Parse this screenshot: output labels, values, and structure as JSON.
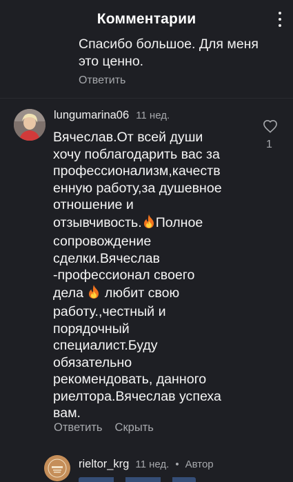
{
  "header": {
    "title": "Комментарии",
    "more_icon": "more-vertical-icon"
  },
  "previous_reply": {
    "text": "Спасибо большое. Для меня это ценно.",
    "reply_label": "Ответить"
  },
  "comment": {
    "username": "lungumarina06",
    "time": "11 нед.",
    "like_icon": "heart-icon",
    "like_count": "1",
    "text_lines": [
      "Вячеслав.От всей души",
      "хочу поблагодарить вас за",
      "профессионализм,качеств",
      "енную работу,за душевное",
      "отношение и",
      "отзывчивость.",
      "Полное",
      "сопровождение",
      "сделки.Вячеслав",
      "-профессионал своего",
      "дела",
      "любит свою",
      "работу.,честный и",
      "порядочный",
      "специалист.Буду",
      "обязательно",
      "рекомендовать, данного",
      "риелтора.Вячеслав успеха",
      "вам."
    ],
    "reply_label": "Ответить",
    "hide_label": "Скрыть"
  },
  "reply": {
    "username": "rieltor_krg",
    "time": "11 нед.",
    "separator": "•",
    "badge": "Автор"
  },
  "colors": {
    "background": "#1e1f24",
    "text": "#f2f2f2",
    "muted": "#a7a9ad"
  }
}
